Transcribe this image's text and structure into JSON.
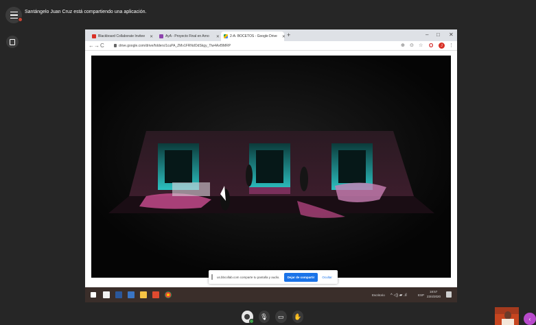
{
  "session": {
    "share_message": "Santángelo Juan Cruz está compartiendo una aplicación."
  },
  "browser": {
    "tabs": [
      {
        "label": "Blackboard Collaborate Invitee",
        "icon": "gmail-icon",
        "color": "#d93025"
      },
      {
        "label": "AyA - Proyecto Final en Arno",
        "icon": "classroom-icon",
        "color": "#8e44ad"
      },
      {
        "label": "2-A- BOCETOS - Google Drive",
        "icon": "drive-icon",
        "color": "#fbbc04"
      }
    ],
    "new_tab": "+",
    "url": "drive.google.com/drive/folders/1cuPA_ZMv1FRNdOdSkgy_Tlw4Axf9MRP",
    "profile_letter": "J",
    "window_controls": {
      "minimize": "–",
      "maximize": "□",
      "close": "✕"
    }
  },
  "taskbar": {
    "desktop_label": "Escritorio",
    "language": "ESP",
    "time": "18:57",
    "date": "23/4/2020"
  },
  "share_notice": {
    "text": "us.bbcollab.com comparte tu pantalla y audio.",
    "stop_label": "Dejar de compartir",
    "hide_label": "Ocultar"
  },
  "colors": {
    "accent": "#1a73e8",
    "scene_teal": "#2cc1c1",
    "scene_magenta": "#c24a8a",
    "collab_purple": "#b84acb"
  }
}
